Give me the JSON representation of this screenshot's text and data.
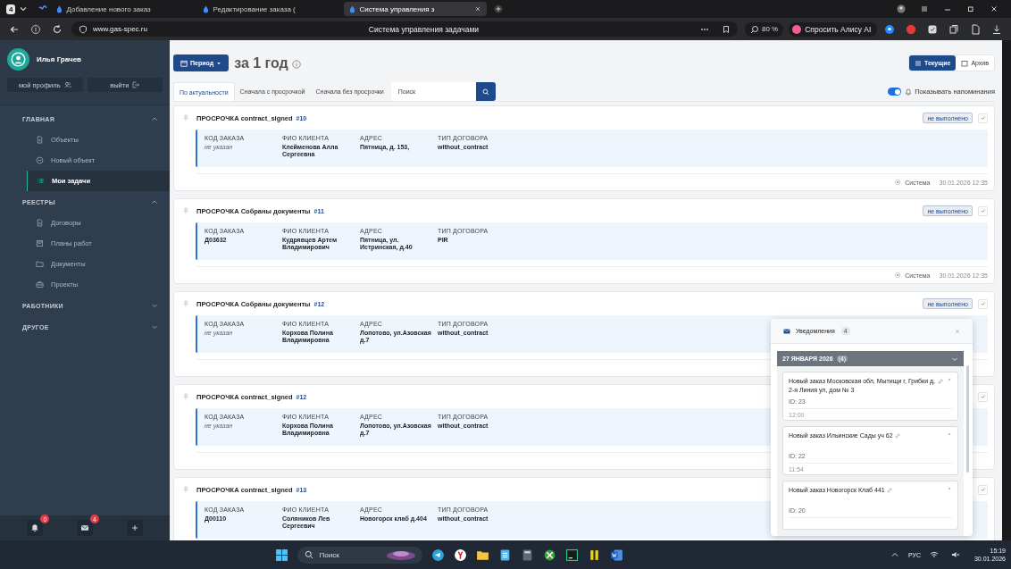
{
  "browser": {
    "tab_count": "4",
    "tabs": [
      {
        "title": "Добавление нового заказ",
        "selected": false
      },
      {
        "title": "Редактирование заказа (",
        "selected": false
      },
      {
        "title": "Система управления з",
        "selected": true
      }
    ],
    "url": "www.gas-spec.ru",
    "page_title": "Система управления задачами",
    "zoom": "80 %",
    "assistant": "Спросить Алису AI"
  },
  "sidebar": {
    "user": "Илья Грачев",
    "profile_button": "мой профиль",
    "logout_button": "выйти",
    "sections": [
      {
        "title": "ГЛАВНАЯ",
        "expanded": true,
        "items": [
          {
            "label": "Объекты",
            "kind": "doc",
            "selected": false
          },
          {
            "label": "Новый объект",
            "kind": "circle",
            "selected": false
          },
          {
            "label": "Мои задачи",
            "kind": "list",
            "selected": true
          }
        ]
      },
      {
        "title": "РЕЕСТРЫ",
        "expanded": true,
        "items": [
          {
            "label": "Договоры",
            "kind": "doc",
            "selected": false
          },
          {
            "label": "Планы работ",
            "kind": "board",
            "selected": false
          },
          {
            "label": "Документы",
            "kind": "folder",
            "selected": false
          },
          {
            "label": "Проекты",
            "kind": "briefcase",
            "selected": false
          }
        ]
      },
      {
        "title": "РАБОТНИКИ",
        "expanded": false
      },
      {
        "title": "ДРУГОЕ",
        "expanded": false
      }
    ],
    "footer": {
      "notifications_badge": "0",
      "messages_badge": "4"
    }
  },
  "header": {
    "period_button": "Период",
    "period": "за 1 год",
    "view_tabs": [
      {
        "label": "Текущие",
        "selected": true
      },
      {
        "label": "Архив",
        "selected": false
      }
    ]
  },
  "sort_tabs": [
    {
      "label": "По актуальности",
      "selected": true
    },
    {
      "label": "Сначала с просрочкой",
      "selected": false
    },
    {
      "label": "Сначала без просрочки",
      "selected": false
    }
  ],
  "search": {
    "placeholder": "Поиск"
  },
  "reminders": {
    "label": "Показывать напоминания",
    "on": true
  },
  "tasks": [
    {
      "title": "ПРОСРОЧКА contract_signed",
      "number": "#10",
      "status": "не выполнено",
      "fields": [
        {
          "label": "КОД ЗАКАЗА",
          "value": "не указан",
          "muted": true
        },
        {
          "label": "ФИО КЛИЕНТА",
          "value": "Клейменова Алла Сергеевна",
          "muted": false
        },
        {
          "label": "АДРЕС",
          "value": "Пятница, д. 153,",
          "muted": false
        },
        {
          "label": "ТИП ДОГОВОРА",
          "value": "without_contract",
          "muted": false
        }
      ],
      "author": "Система",
      "datetime": "30.01.2026 12:35"
    },
    {
      "title": "ПРОСРОЧКА Собраны документы",
      "number": "#11",
      "status": "не выполнено",
      "fields": [
        {
          "label": "КОД ЗАКАЗА",
          "value": "Д03632",
          "muted": false
        },
        {
          "label": "ФИО КЛИЕНТА",
          "value": "Кудрявцев Артем Владимирович",
          "muted": false
        },
        {
          "label": "АДРЕС",
          "value": "Пятница, ул. Истринская, д.40",
          "muted": false
        },
        {
          "label": "ТИП ДОГОВОРА",
          "value": "PIR",
          "muted": false
        }
      ],
      "author": "Система",
      "datetime": "30.01.2026 12:35"
    },
    {
      "title": "ПРОСРОЧКА Собраны документы",
      "number": "#12",
      "status": "не выполнено",
      "fields": [
        {
          "label": "КОД ЗАКАЗА",
          "value": "не указан",
          "muted": true
        },
        {
          "label": "ФИО КЛИЕНТА",
          "value": "Корхова Полина Владимировна",
          "muted": false
        },
        {
          "label": "АДРЕС",
          "value": "Лопотово, ул.Азовская д.7",
          "muted": false
        },
        {
          "label": "ТИП ДОГОВОРА",
          "value": "without_contract",
          "muted": false
        }
      ]
    },
    {
      "title": "ПРОСРОЧКА contract_signed",
      "number": "#12",
      "fields": [
        {
          "label": "КОД ЗАКАЗА",
          "value": "не указан",
          "muted": true
        },
        {
          "label": "ФИО КЛИЕНТА",
          "value": "Корхова Полина Владимировна",
          "muted": false
        },
        {
          "label": "АДРЕС",
          "value": "Лопотово, ул.Азовская д.7",
          "muted": false
        },
        {
          "label": "ТИП ДОГОВОРА",
          "value": "without_contract",
          "muted": false
        }
      ]
    },
    {
      "title": "ПРОСРОЧКА contract_signed",
      "number": "#13",
      "fields": [
        {
          "label": "КОД ЗАКАЗА",
          "value": "Д00110",
          "muted": false
        },
        {
          "label": "ФИО КЛИЕНТА",
          "value": "Соляников Лев Сергеевич",
          "muted": false
        },
        {
          "label": "АДРЕС",
          "value": "Новогорск клаб д.404",
          "muted": false
        },
        {
          "label": "ТИП ДОГОВОРА",
          "value": "without_contract",
          "muted": false
        }
      ]
    }
  ],
  "notifications": {
    "title": "Уведомления",
    "count": "4",
    "group": {
      "date": "27 ЯНВАРЯ 2026",
      "count": "(4)",
      "expanded": true,
      "items": [
        {
          "text": "Новый заказ Московская обл, Мытищи г, Грибки д, 2-я Линия ул, дом № 3",
          "id": "ID: 23",
          "time": "12:00"
        },
        {
          "text": "Новый заказ Ильинские Сады уч 62",
          "id": "ID: 22",
          "time": "11:54"
        },
        {
          "text": "Новый заказ Новогорск Клаб 441",
          "id": "ID: 20"
        }
      ]
    }
  },
  "taskbar": {
    "search": "Поиск",
    "language": "РУС",
    "time": "15:19",
    "date": "30.01.2026"
  }
}
